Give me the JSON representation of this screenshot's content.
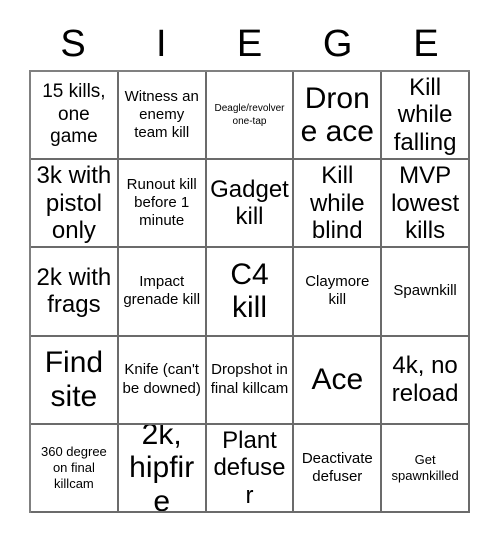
{
  "card": {
    "title_letters": [
      "S",
      "I",
      "E",
      "G",
      "E"
    ],
    "grid_size": 5,
    "colors": {
      "background": "#ffffff",
      "text": "#000000",
      "grid_line": "#6b6b6b",
      "grid_outer_line": "#808080"
    },
    "rows": [
      [
        {
          "text": "15 kills, one game",
          "size": "lg"
        },
        {
          "text": "Witness an enemy team kill",
          "size": "md"
        },
        {
          "text": "Deagle/revolver one-tap",
          "size": "xs"
        },
        {
          "text": "Drone ace",
          "size": "xxl"
        },
        {
          "text": "Kill while falling",
          "size": "xl"
        }
      ],
      [
        {
          "text": "3k with pistol only",
          "size": "xl"
        },
        {
          "text": "Runout kill before 1 minute",
          "size": "md"
        },
        {
          "text": "Gadget kill",
          "size": "xl"
        },
        {
          "text": "Kill while blind",
          "size": "xl"
        },
        {
          "text": "MVP lowest kills",
          "size": "xl"
        }
      ],
      [
        {
          "text": "2k with frags",
          "size": "xl"
        },
        {
          "text": "Impact grenade kill",
          "size": "md"
        },
        {
          "text": "C4 kill",
          "size": "xxl"
        },
        {
          "text": "Claymore kill",
          "size": "md"
        },
        {
          "text": "Spawnkill",
          "size": "md"
        }
      ],
      [
        {
          "text": "Find site",
          "size": "xxl"
        },
        {
          "text": "Knife (can't be downed)",
          "size": "md"
        },
        {
          "text": "Dropshot in final killcam",
          "size": "md"
        },
        {
          "text": "Ace",
          "size": "xxl"
        },
        {
          "text": "4k, no reload",
          "size": "xl"
        }
      ],
      [
        {
          "text": "360 degree on final killcam",
          "size": "sm"
        },
        {
          "text": "2k, hipfire",
          "size": "xxl"
        },
        {
          "text": "Plant defuser",
          "size": "xl"
        },
        {
          "text": "Deactivate defuser",
          "size": "md"
        },
        {
          "text": "Get spawnkilled",
          "size": "sm"
        }
      ]
    ]
  }
}
